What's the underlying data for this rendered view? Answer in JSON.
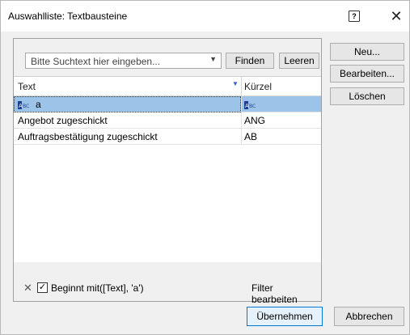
{
  "window": {
    "title": "Auswahlliste: Textbausteine",
    "help_glyph": "?",
    "close_glyph": "✕"
  },
  "search": {
    "placeholder": "Bitte Suchtext hier eingeben...",
    "find_label": "Finden",
    "clear_label": "Leeren"
  },
  "grid": {
    "columns": [
      "Text",
      "Kürzel"
    ],
    "rows": [
      {
        "text": "a",
        "kuerzel": "",
        "selected": true,
        "has_icon": true
      },
      {
        "text": "Angebot zugeschickt",
        "kuerzel": "ANG",
        "selected": false,
        "has_icon": false
      },
      {
        "text": "Auftragsbestätigung zugeschickt",
        "kuerzel": "AB",
        "selected": false,
        "has_icon": false
      }
    ]
  },
  "filter": {
    "clear_glyph": "✕",
    "checked": true,
    "expression": "Beginnt mit([Text], 'a')",
    "edit_label": "Filter bearbeiten"
  },
  "side_buttons": {
    "new": "Neu...",
    "edit": "Bearbeiten...",
    "delete": "Löschen"
  },
  "footer": {
    "ok": "Übernehmen",
    "cancel": "Abbrechen"
  },
  "colors": {
    "selection": "#9cc4e8",
    "default_button_border": "#0078d7"
  }
}
